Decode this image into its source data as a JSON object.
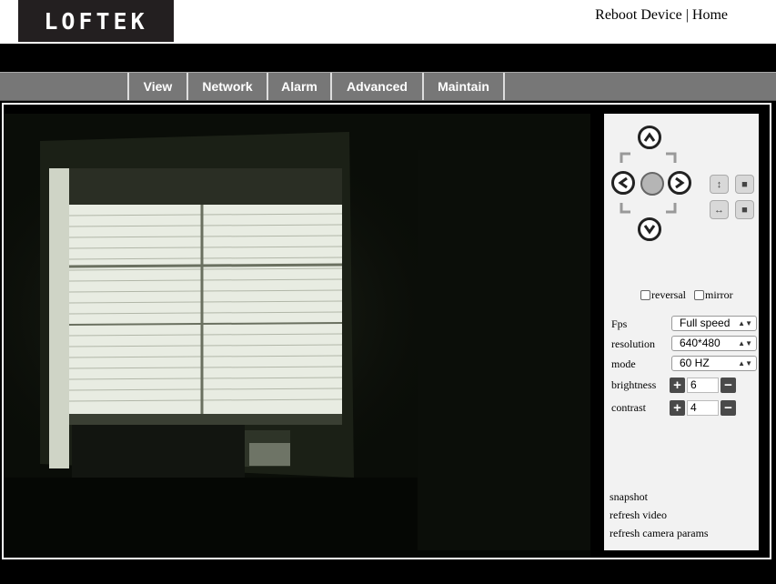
{
  "brand": {
    "logo_text": "LOFTEK"
  },
  "header": {
    "reboot_label": "Reboot Device",
    "separator": "|",
    "home_label": "Home"
  },
  "nav": {
    "items": [
      "View",
      "Network",
      "Alarm",
      "Advanced",
      "Maintain"
    ]
  },
  "ptz": {
    "up_icon": "arrow-up-icon",
    "down_icon": "arrow-down-icon",
    "left_icon": "arrow-left-icon",
    "right_icon": "arrow-right-icon",
    "vertical_patrol_icon": "vertical-arrows-icon",
    "horizontal_patrol_icon": "horizontal-arrows-icon",
    "stop_icon": "stop-icon"
  },
  "options": {
    "reversal_label": "reversal",
    "mirror_label": "mirror"
  },
  "settings": {
    "fps_label": "Fps",
    "fps_value": "Full speed",
    "resolution_label": "resolution",
    "resolution_value": "640*480",
    "mode_label": "mode",
    "mode_value": "60 HZ",
    "brightness_label": "brightness",
    "brightness_value": "6",
    "contrast_label": "contrast",
    "contrast_value": "4"
  },
  "actions": {
    "snapshot": "snapshot",
    "refresh_video": "refresh video",
    "refresh_params": "refresh camera params"
  },
  "colors": {
    "nav_bg": "#777777",
    "panel_bg": "#f2f2f2",
    "logo_bg": "#231f20"
  }
}
